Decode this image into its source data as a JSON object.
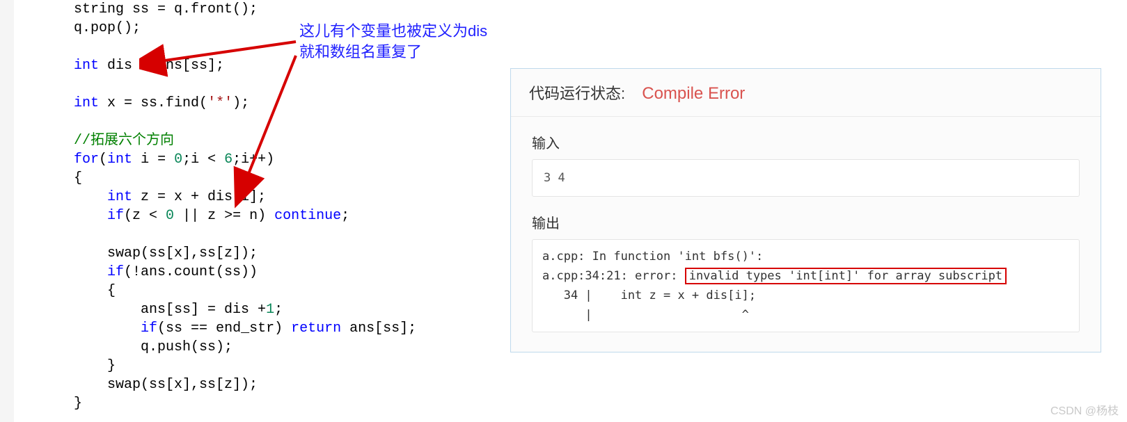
{
  "annotation": {
    "line1": "这儿有个变量也被定义为dis",
    "line2": "就和数组名重复了"
  },
  "code_tokens": [
    [
      [
        "id",
        "    string ss = q.front();"
      ]
    ],
    [
      [
        "id",
        "    q.pop();"
      ]
    ],
    [
      [
        "id",
        ""
      ]
    ],
    [
      [
        "id",
        "    "
      ],
      [
        "key",
        "int"
      ],
      [
        "id",
        " dis = ans[ss];"
      ]
    ],
    [
      [
        "id",
        ""
      ]
    ],
    [
      [
        "id",
        "    "
      ],
      [
        "key",
        "int"
      ],
      [
        "id",
        " x = ss.find("
      ],
      [
        "str",
        "'*'"
      ],
      [
        "id",
        ");"
      ]
    ],
    [
      [
        "id",
        ""
      ]
    ],
    [
      [
        "id",
        "    "
      ],
      [
        "com",
        "//拓展六个方向"
      ]
    ],
    [
      [
        "id",
        "    "
      ],
      [
        "key",
        "for"
      ],
      [
        "id",
        "("
      ],
      [
        "key",
        "int"
      ],
      [
        "id",
        " i = "
      ],
      [
        "num",
        "0"
      ],
      [
        "id",
        ";i < "
      ],
      [
        "num",
        "6"
      ],
      [
        "id",
        ";i++)"
      ]
    ],
    [
      [
        "id",
        "    {"
      ]
    ],
    [
      [
        "id",
        "        "
      ],
      [
        "key",
        "int"
      ],
      [
        "id",
        " z = x + dis[i];"
      ]
    ],
    [
      [
        "id",
        "        "
      ],
      [
        "key",
        "if"
      ],
      [
        "id",
        "(z < "
      ],
      [
        "num",
        "0"
      ],
      [
        "id",
        " || z >= n) "
      ],
      [
        "key",
        "continue"
      ],
      [
        "id",
        ";"
      ]
    ],
    [
      [
        "id",
        ""
      ]
    ],
    [
      [
        "id",
        "        swap(ss[x],ss[z]);"
      ]
    ],
    [
      [
        "id",
        "        "
      ],
      [
        "key",
        "if"
      ],
      [
        "id",
        "(!ans.count(ss))"
      ]
    ],
    [
      [
        "id",
        "        {"
      ]
    ],
    [
      [
        "id",
        "            ans[ss] = dis +"
      ],
      [
        "num",
        "1"
      ],
      [
        "id",
        ";"
      ]
    ],
    [
      [
        "id",
        "            "
      ],
      [
        "key",
        "if"
      ],
      [
        "id",
        "(ss == end_str) "
      ],
      [
        "key",
        "return"
      ],
      [
        "id",
        " ans[ss];"
      ]
    ],
    [
      [
        "id",
        "            q.push(ss);"
      ]
    ],
    [
      [
        "id",
        "        }"
      ]
    ],
    [
      [
        "id",
        "        swap(ss[x],ss[z]);"
      ]
    ],
    [
      [
        "id",
        "    }"
      ]
    ]
  ],
  "panel": {
    "header_label": "代码运行状态:",
    "status_text": "Compile Error",
    "input_label": "输入",
    "input_text": "3 4",
    "output_label": "输出",
    "error": {
      "l1_pre": "a.cpp: In function 'int bfs()':",
      "l2_pre": "a.cpp:34:21: error: ",
      "l2_hl": "invalid types 'int[int]' for array subscript",
      "l3": "   34 |    int z = x + dis[i];",
      "l4": "      |                     ^"
    }
  },
  "watermark": "CSDN @杨枝"
}
